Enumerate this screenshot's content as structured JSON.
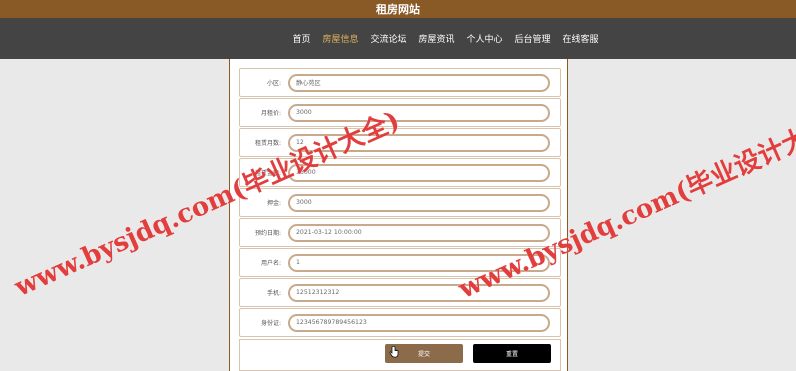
{
  "site_title": "租房网站",
  "nav": [
    "首页",
    "房屋信息",
    "交流论坛",
    "房屋资讯",
    "个人中心",
    "后台管理",
    "在线客服"
  ],
  "form": {
    "fields": [
      {
        "label": "小区:",
        "value": "静心苑区"
      },
      {
        "label": "月租价:",
        "value": "3000"
      },
      {
        "label": "租赁月数:",
        "value": "12"
      },
      {
        "label": "租赁金额:",
        "value": "36000"
      },
      {
        "label": "押金:",
        "value": "3000"
      },
      {
        "label": "预约日期:",
        "value": "2021-03-12 10:00:00"
      },
      {
        "label": "用户名:",
        "value": "1"
      },
      {
        "label": "手机:",
        "value": "12512312312"
      },
      {
        "label": "身份证:",
        "value": "123456789789456123"
      }
    ],
    "submit_label": "提交",
    "reset_label": "重置"
  },
  "watermark": {
    "text": "www.bysjdq.com(毕业设计大全)"
  },
  "colors": {
    "brand": "#8a5a26",
    "nav_bg": "#444444",
    "nav_active": "#e0b45a",
    "watermark": "#dc1414"
  }
}
